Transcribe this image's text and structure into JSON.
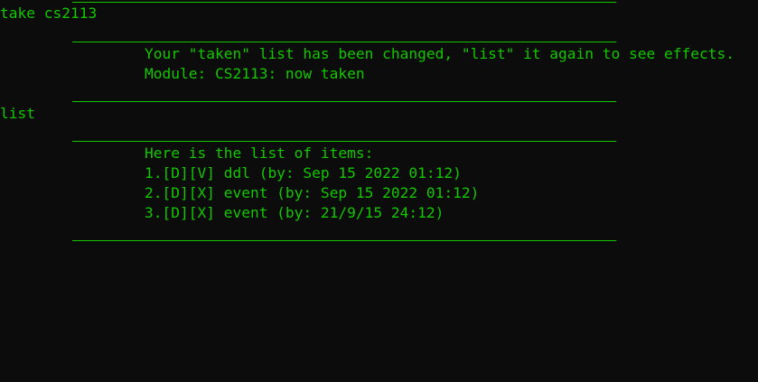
{
  "session": {
    "command1": "take cs2113",
    "response1": [
      "Your \"taken\" list has been changed, \"list\" it again to see effects.",
      "Module: CS2113: now taken"
    ],
    "command2": "list",
    "response2": {
      "header": "Here is the list of items:",
      "items": [
        "1.[D][V] ddl (by: Sep 15 2022 01:12)",
        "2.[D][X] event (by: Sep 15 2022 01:12)",
        "3.[D][X] event (by: 21/9/15 24:12)"
      ]
    }
  },
  "colors": {
    "background": "#0c0c0c",
    "text": "#13c600"
  }
}
